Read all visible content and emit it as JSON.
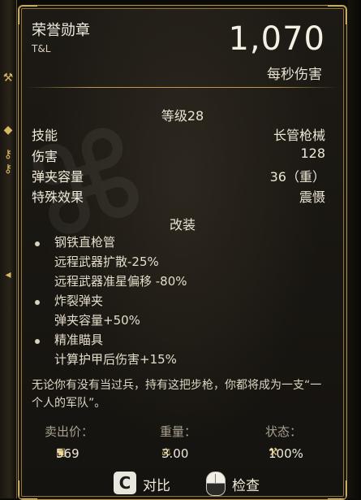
{
  "item": {
    "name": "荣誉勋章",
    "brand": "T&L",
    "dps": "1,070",
    "dps_label": "每秒伤害",
    "level": "等级28"
  },
  "stats": [
    {
      "key": "技能",
      "value": "长管枪械"
    },
    {
      "key": "伤害",
      "value": "128"
    },
    {
      "key": "弹夹容量",
      "value": "36（重）"
    },
    {
      "key": "特殊效果",
      "value": "震慑"
    }
  ],
  "mods": {
    "title": "改装",
    "groups": [
      {
        "name": "钢铁直枪管",
        "effects": [
          "远程武器扩散-25%",
          "远程武器准星偏移 -80%"
        ]
      },
      {
        "name": "炸裂弹夹",
        "effects": [
          "弹夹容量+50%"
        ]
      },
      {
        "name": "精准瞄具",
        "effects": [
          "计算护甲后伤害+15%"
        ]
      }
    ]
  },
  "description": "无论你有没有当过兵，持有这把步枪，你都将成为一支“一个人的军队”。",
  "footer": {
    "sell_label": "卖出价：",
    "weight_label": "重量：",
    "condition_label": "状态：",
    "sell_value": "569",
    "weight_value": "3.00",
    "condition_value": "100%",
    "sell_icon": "caps-icon",
    "weight_icon": "weight-icon",
    "condition_icon": "wrench-icon"
  },
  "actions": {
    "compare_key": "C",
    "compare_label": "对比",
    "inspect_label": "检查"
  },
  "colors": {
    "accent_gold": "#b9984f",
    "text": "#ece6d6",
    "panel_bg": "#1a1712"
  }
}
